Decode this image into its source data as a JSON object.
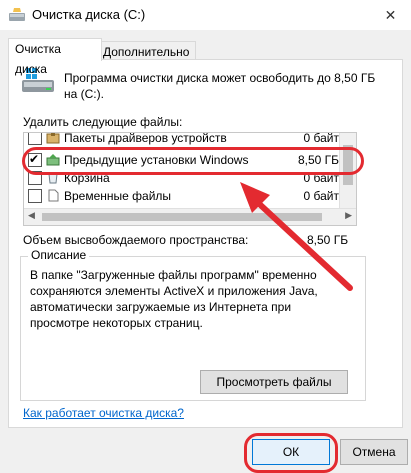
{
  "window": {
    "title": "Очистка диска  (C:)",
    "close_glyph": "✕"
  },
  "tabs": [
    {
      "label": "Очистка диска",
      "active": true
    },
    {
      "label": "Дополнительно",
      "active": false
    }
  ],
  "intro": "Программа очистки диска может освободить до 8,50 ГБ на  (C:).",
  "files_label": "Удалить следующие файлы:",
  "files": [
    {
      "name": "Пакеты драйверов устройств",
      "size": "0 байт",
      "checked": false,
      "icon": "package-icon"
    },
    {
      "name": "Предыдущие установки Windows",
      "size": "8,50 ГБ",
      "checked": true,
      "icon": "windows-install-icon"
    },
    {
      "name": "Корзина",
      "size": "0 байт",
      "checked": false,
      "icon": "recycle-bin-icon"
    },
    {
      "name": "Временные файлы",
      "size": "0 байт",
      "checked": false,
      "icon": "file-icon"
    }
  ],
  "freed": {
    "label": "Объем высвобождаемого пространства:",
    "value": "8,50 ГБ"
  },
  "description": {
    "legend": "Описание",
    "text": "В папке \"Загруженные файлы программ\" временно сохраняются элементы ActiveX и приложения Java, автоматически загружаемые из Интернета при просмотре некоторых страниц."
  },
  "view_files_button": "Просмотреть файлы",
  "help_link": "Как работает очистка диска?",
  "ok_button": "ОК",
  "cancel_button": "Отмена",
  "colors": {
    "annotation": "#e32a30",
    "link": "#0066cc",
    "accent": "#0078d7"
  }
}
